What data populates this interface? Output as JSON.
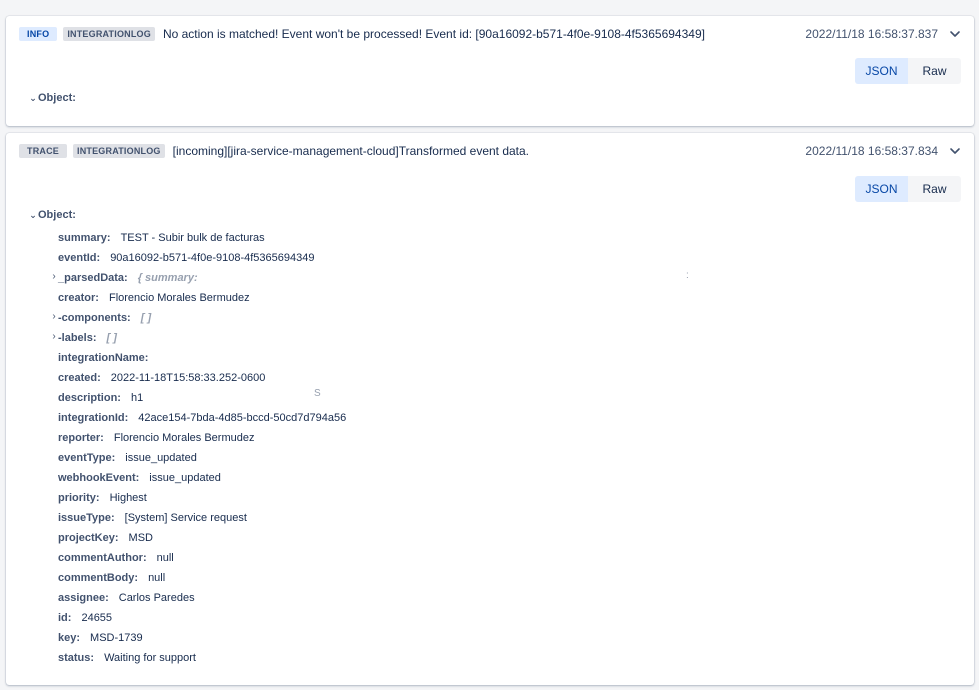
{
  "logs": [
    {
      "level": "INFO",
      "source": "INTEGRATIONLOG",
      "message": "No action is matched! Event won't be processed! Event id: [90a16092-b571-4f0e-9108-4f5365694349]",
      "timestamp": "2022/11/18 16:58:37.837",
      "toggle": {
        "json_label": "JSON",
        "raw_label": "Raw"
      },
      "root_label": "Object:"
    },
    {
      "level": "TRACE",
      "source": "INTEGRATIONLOG",
      "message": "[incoming][jira-service-management-cloud]Transformed event data.",
      "timestamp": "2022/11/18 16:58:37.834",
      "toggle": {
        "json_label": "JSON",
        "raw_label": "Raw"
      },
      "root_label": "Object:",
      "fields": [
        {
          "key": "summary:",
          "value": "TEST - Subir bulk de facturas"
        },
        {
          "key": "eventId:",
          "value": "90a16092-b571-4f0e-9108-4f5365694349"
        },
        {
          "key": "_parsedData:",
          "value": "{ summary:",
          "expandable": true,
          "muted": true
        },
        {
          "key": "creator:",
          "value": "Florencio Morales Bermudez"
        },
        {
          "key": "-components:",
          "value": "[ ]",
          "expandable": true,
          "muted": true
        },
        {
          "key": "-labels:",
          "value": "[ ]",
          "expandable": true,
          "muted": true
        },
        {
          "key": "integrationName:",
          "value": ""
        },
        {
          "key": "created:",
          "value": "2022-11-18T15:58:33.252-0600"
        },
        {
          "key": "description:",
          "value": "h1"
        },
        {
          "key": "integrationId:",
          "value": "42ace154-7bda-4d85-bccd-50cd7d794a56"
        },
        {
          "key": "reporter:",
          "value": "Florencio Morales Bermudez"
        },
        {
          "key": "eventType:",
          "value": "issue_updated"
        },
        {
          "key": "webhookEvent:",
          "value": "issue_updated"
        },
        {
          "key": "priority:",
          "value": "Highest"
        },
        {
          "key": "issueType:",
          "value": "[System] Service request"
        },
        {
          "key": "projectKey:",
          "value": "MSD"
        },
        {
          "key": "commentAuthor:",
          "value": "null"
        },
        {
          "key": "commentBody:",
          "value": "null"
        },
        {
          "key": "assignee:",
          "value": "Carlos Paredes"
        },
        {
          "key": "id:",
          "value": "24655"
        },
        {
          "key": "key:",
          "value": "MSD-1739"
        },
        {
          "key": "status:",
          "value": "Waiting for support"
        }
      ],
      "stray_marks": [
        ":",
        "S"
      ]
    }
  ],
  "icons": {
    "expand": "chevron-down-icon",
    "tree_collapse": "caret-down-icon",
    "tree_expand": "caret-right-icon"
  }
}
